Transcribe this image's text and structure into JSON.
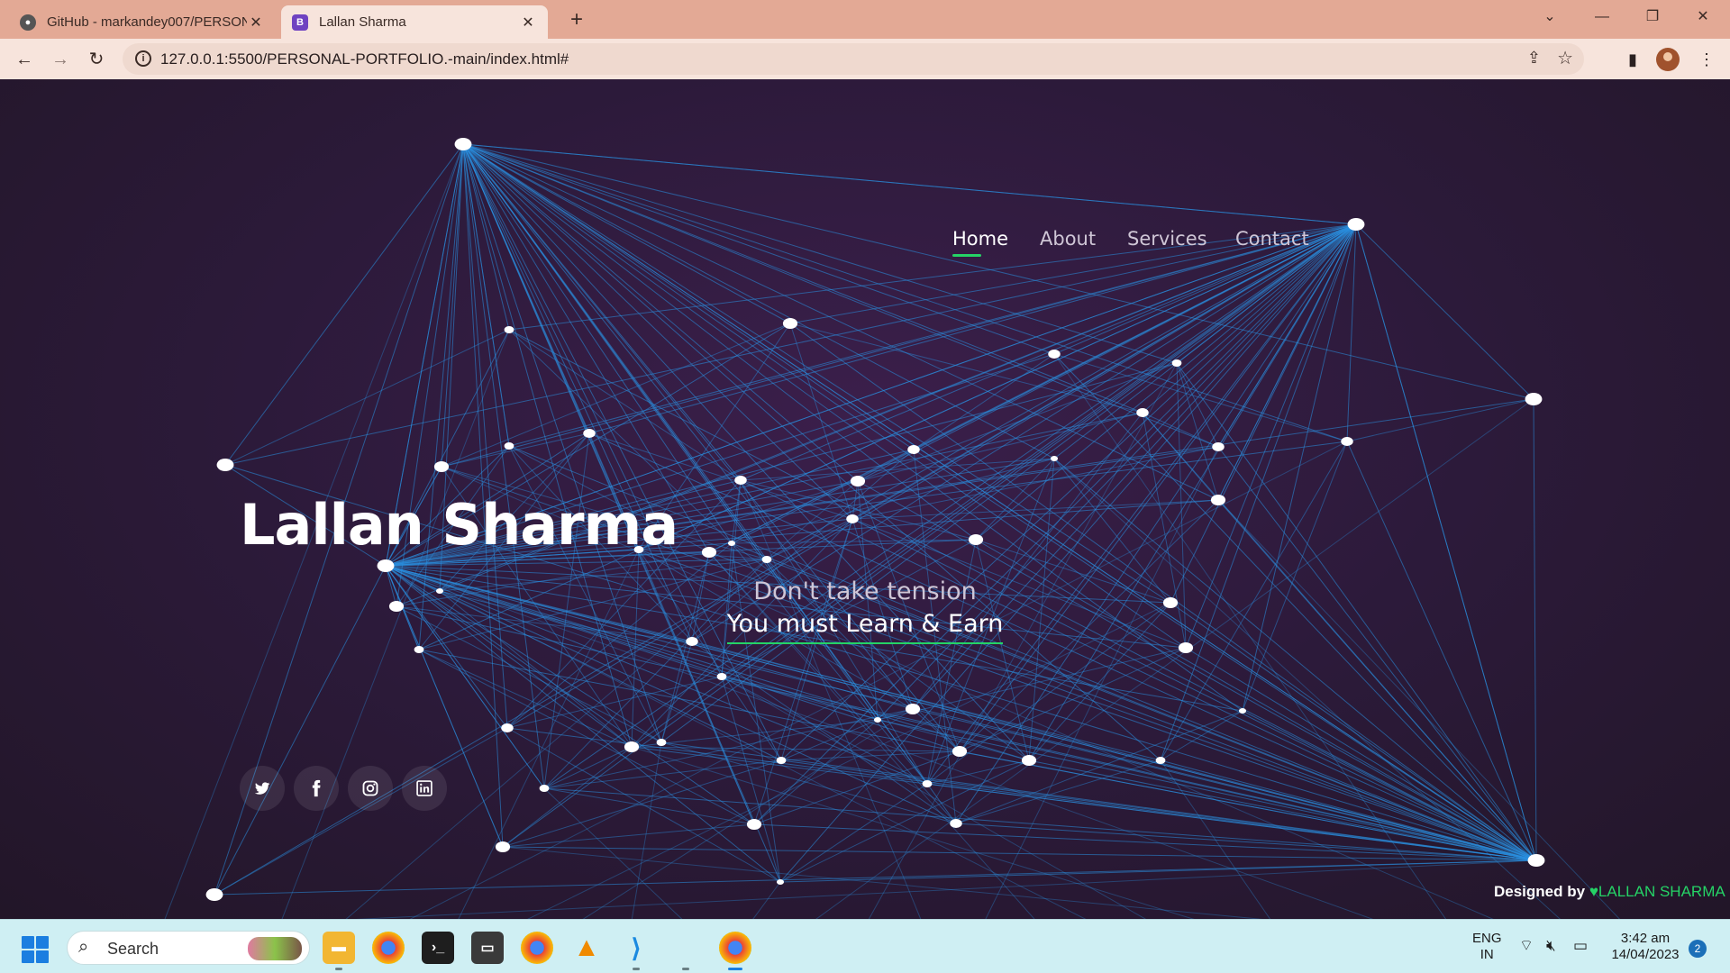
{
  "browser": {
    "tabs": [
      {
        "title": "GitHub - markandey007/PERSON",
        "favicon": "github-icon",
        "active": false
      },
      {
        "title": "Lallan Sharma",
        "favicon": "bootstrap-icon",
        "active": true
      }
    ],
    "new_tab_symbol": "+",
    "url": "127.0.0.1:5500/PERSONAL-PORTFOLIO.-main/index.html#"
  },
  "page": {
    "nav": [
      "Home",
      "About",
      "Services",
      "Contact"
    ],
    "active_nav": "Home",
    "name": "Lallan Sharma",
    "tagline_line1": "Don't take tension",
    "tagline_line2": "You must Learn & Earn",
    "socials": [
      "twitter-icon",
      "facebook-icon",
      "instagram-icon",
      "linkedin-icon"
    ],
    "credit_prefix": "Designed by",
    "credit_name": "LALLAN SHARMA",
    "colors": {
      "accent": "#25d366",
      "network_line": "#2a8fe0",
      "background": "#2c1a3a"
    }
  },
  "taskbar": {
    "search_placeholder": "Search",
    "apps": [
      "file-explorer-icon",
      "chrome-icon",
      "terminal-icon",
      "app-icon",
      "chrome-icon",
      "vlc-icon",
      "vscode-icon",
      "chrome-icon"
    ],
    "language": "ENG",
    "region": "IN",
    "time": "3:42 am",
    "date": "14/04/2023",
    "notifications": "2"
  }
}
